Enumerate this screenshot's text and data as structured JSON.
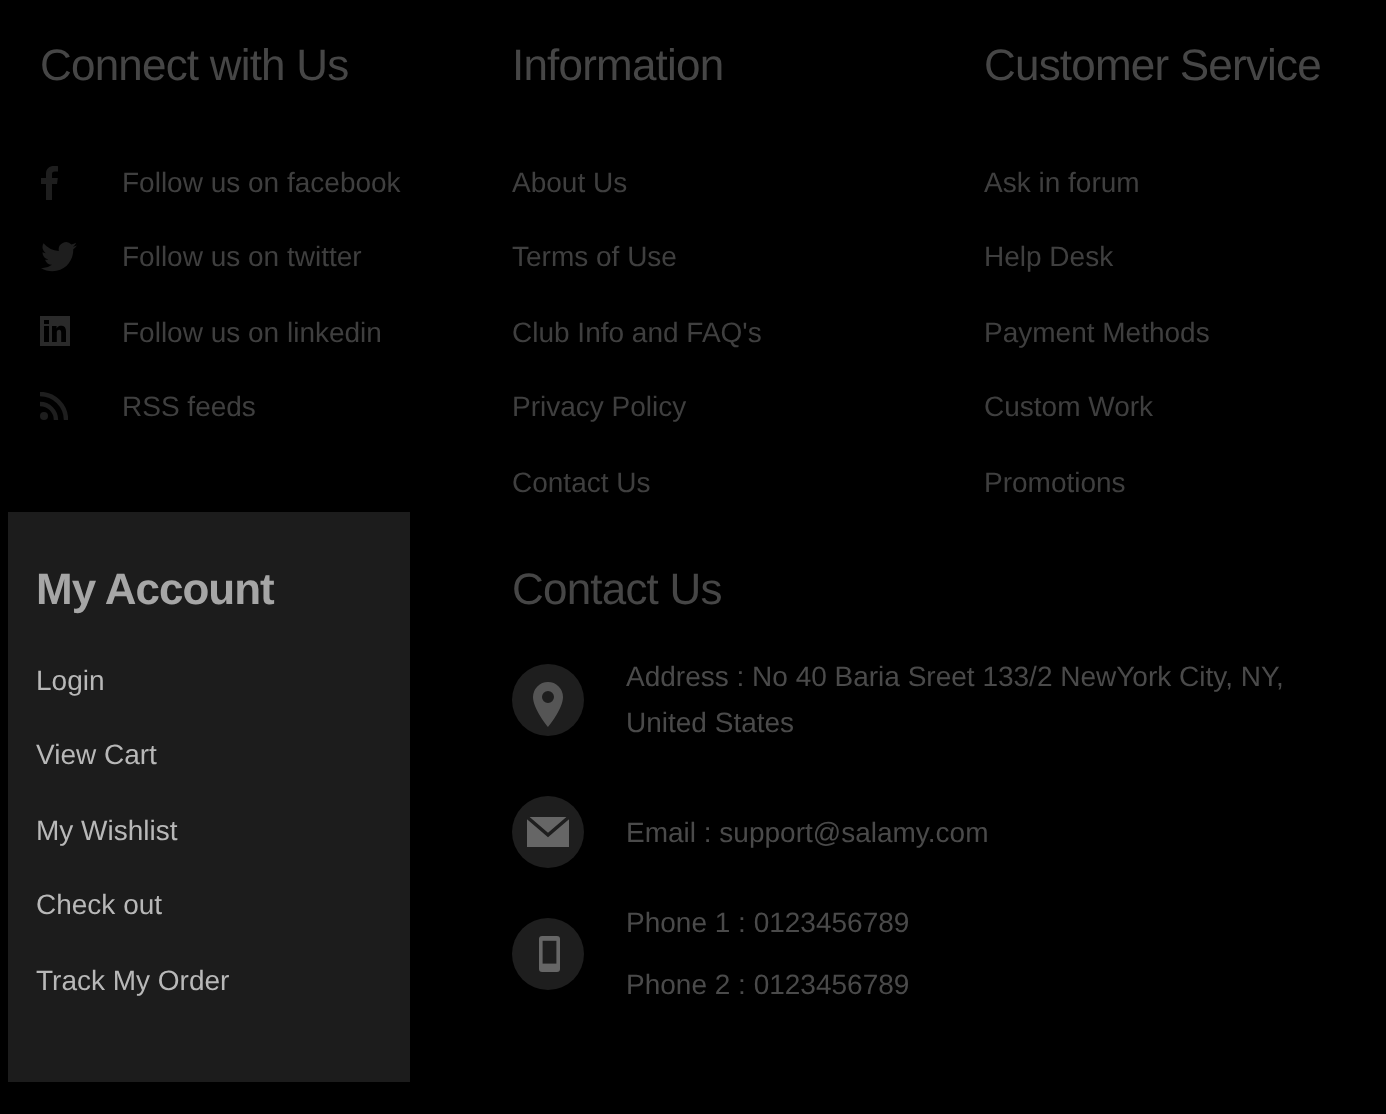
{
  "connect": {
    "title": "Connect with Us",
    "items": [
      {
        "kind": "facebook",
        "label": "Follow us on facebook"
      },
      {
        "kind": "twitter",
        "label": "Follow us on twitter"
      },
      {
        "kind": "linkedin",
        "label": "Follow us on linkedin"
      },
      {
        "kind": "rss",
        "label": "RSS feeds"
      }
    ]
  },
  "information": {
    "title": "Information",
    "links": [
      "About Us",
      "Terms of Use",
      "Club Info and FAQ's",
      "Privacy Policy",
      "Contact Us"
    ]
  },
  "customer_service": {
    "title": "Customer Service",
    "links": [
      "Ask in forum",
      "Help Desk",
      "Payment Methods",
      "Custom Work",
      "Promotions"
    ]
  },
  "my_account": {
    "title": "My Account",
    "links": [
      "Login",
      "View Cart",
      "My Wishlist",
      "Check out",
      "Track My Order"
    ]
  },
  "contact_us": {
    "title": "Contact Us",
    "items": [
      {
        "kind": "address",
        "lines": [
          "Address : No 40 Baria Sreet 133/2 NewYork City, NY, United States"
        ]
      },
      {
        "kind": "email",
        "lines": [
          "Email : support@salamy.com"
        ]
      },
      {
        "kind": "phone",
        "lines": [
          "Phone 1 : 0123456789",
          "Phone 2 : 0123456789"
        ]
      }
    ]
  }
}
